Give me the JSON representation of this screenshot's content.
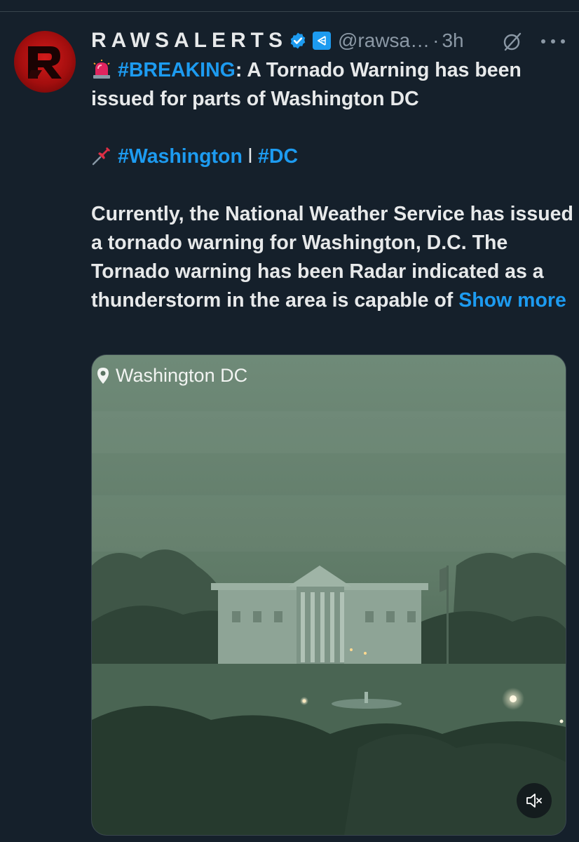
{
  "tweet": {
    "display_name": "RAWSALERTS",
    "handle": "@rawsa…",
    "separator": "·",
    "timestamp": "3h",
    "icons": {
      "avatar": "rawsalerts-logo",
      "verified": "verified-badge-icon",
      "affiliate": "affiliate-badge-icon",
      "grok": "grok-icon",
      "more": "more-options-icon"
    },
    "line1": {
      "emoji": "🚨",
      "hashtag": "#BREAKING",
      "text": ": A Tornado Warning has been issued for parts of Washington DC"
    },
    "line2": {
      "emoji": "📌",
      "hashtag1": "#Washington",
      "separator": "l",
      "hashtag2": "#DC"
    },
    "body": "Currently, the National Weather Service has issued a tornado warning for Washington, D.C. The Tornado warning has been Radar indicated as a thunderstorm in the area is capable of",
    "show_more": "Show more",
    "media": {
      "location_label": "Washington DC",
      "location_icon": "location-pin-icon",
      "mute_icon": "volume-muted-icon",
      "description_scene": "white-house-storm-video"
    },
    "colors": {
      "background": "#15202b",
      "link": "#1d9bf0",
      "muted": "#8b98a5",
      "text": "#e7e9ea"
    }
  }
}
